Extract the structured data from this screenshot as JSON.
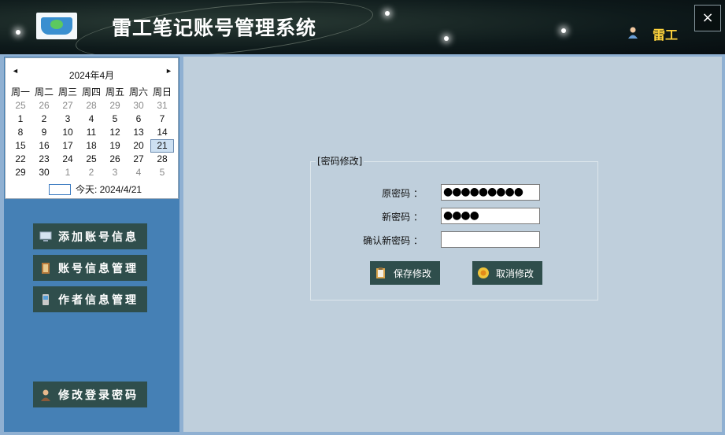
{
  "header": {
    "title": "雷工笔记账号管理系统",
    "user_name": "雷工",
    "close_label": "×"
  },
  "calendar": {
    "prev": "◄",
    "next": "►",
    "title": "2024年4月",
    "weekdays": [
      "周一",
      "周二",
      "周三",
      "周四",
      "周五",
      "周六",
      "周日"
    ],
    "weeks": [
      [
        "25",
        "26",
        "27",
        "28",
        "29",
        "30",
        "31"
      ],
      [
        "1",
        "2",
        "3",
        "4",
        "5",
        "6",
        "7"
      ],
      [
        "8",
        "9",
        "10",
        "11",
        "12",
        "13",
        "14"
      ],
      [
        "15",
        "16",
        "17",
        "18",
        "19",
        "20",
        "21"
      ],
      [
        "22",
        "23",
        "24",
        "25",
        "26",
        "27",
        "28"
      ],
      [
        "29",
        "30",
        "1",
        "2",
        "3",
        "4",
        "5"
      ]
    ],
    "today_label": "今天: 2024/4/21"
  },
  "sidebar": {
    "add_account": "添加账号信息",
    "account_manage": "账号信息管理",
    "author_manage": "作者信息管理",
    "change_password": "修改登录密码"
  },
  "form": {
    "group_title": "[密码修改]",
    "old_label": "原密码 ：",
    "old_value": "●●●●●●●●●",
    "new_label": "新密码 ：",
    "new_value": "●●●●",
    "confirm_label": "确认新密码 ：",
    "confirm_value": "",
    "save_label": "保存修改",
    "cancel_label": "取消修改"
  },
  "colors": {
    "sidebar_bg": "#4580b5",
    "button_bg": "#2f4e4c",
    "main_bg": "#bfcfdc",
    "username": "#ffd33c"
  }
}
